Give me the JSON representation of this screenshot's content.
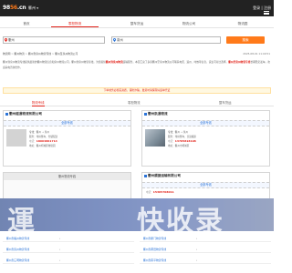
{
  "header": {
    "logo_left": "98",
    "logo_num": "56",
    "logo_right": ".cn",
    "city": "衢州",
    "login": "登录 | 注册"
  },
  "nav": {
    "tabs": [
      {
        "label": "首页"
      },
      {
        "label": "零担物流"
      },
      {
        "label": "整车货运"
      },
      {
        "label": "物流公司"
      },
      {
        "label": "物流园"
      }
    ]
  },
  "search": {
    "from": "衢州",
    "to": "泉州",
    "button": "搜索"
  },
  "breadcrumb": {
    "items": [
      "物流网",
      "衢州物流",
      "衢州到泉州物流专线",
      "衢州至泉州物流公司"
    ],
    "date": "2025-08-01 11:40:51"
  },
  "intro": {
    "part1": "衢州到泉州物流专线提供最新的衢州物流信息和泉州物流公司，衢州到泉州物流专线，为您提供",
    "highlight1": "衢州到泉州物流",
    "part2": "运输服务。本页汇总了多家衢州至泉州物流公司联系电话、运价、时效等信息，货主可对比选择。",
    "highlight2": "衢州至泉州物流专线",
    "part3": "长期稳定发车，欢迎来电咨询合作。"
  },
  "notice": "下单前务必核实资质，谨防诈骗，发货时请保存好运单凭证",
  "subtabs": [
    {
      "label": "物流专线"
    },
    {
      "label": "零担物流"
    },
    {
      "label": "整车货运"
    }
  ],
  "companies": [
    {
      "title": "衢州越通物流有限公司",
      "link": "全部专线",
      "line1": "专线：衢州 → 泉州",
      "line2": "服务：零担整车、仓储配送",
      "phone_label": "电话：",
      "phone": "18664861714",
      "line4": "地址：衢州柯城区物流园"
    },
    {
      "title": "衢州凯通物流",
      "link": "全部专线",
      "line1": "专线：衢州 → 泉州",
      "line2": "服务：零担整车、长途搬家",
      "phone_label": "电话：",
      "phone": "13705818198",
      "line4": "地址：衢州市柯城区"
    },
    {
      "title": "衢州顺捷运输有限公司",
      "link": "全部专线",
      "line1": "专线：衢州 → 泉州",
      "line2": "服务：零担、整车、回程车",
      "phone_label": "电话：",
      "phone": "15305708011",
      "line4": "地址：衢州衢江区"
    }
  ],
  "route_card": {
    "title": "衢州物流专线"
  },
  "routes": [
    {
      "left": "衢州到福州物流专线",
      "right": "衢州到厦门物流专线"
    },
    {
      "left": "衢州到漳州物流专线",
      "right": "衢州到莆田物流专线"
    },
    {
      "left": "衢州到三明物流专线",
      "right": "衢州到南平物流专线"
    }
  ],
  "watermark": {
    "left": "運",
    "right": "快收录"
  },
  "colors": {
    "accent": "#e2231a",
    "brand_orange": "#ff7a1a",
    "link_blue": "#2b74d8",
    "topbar": "#222222"
  }
}
